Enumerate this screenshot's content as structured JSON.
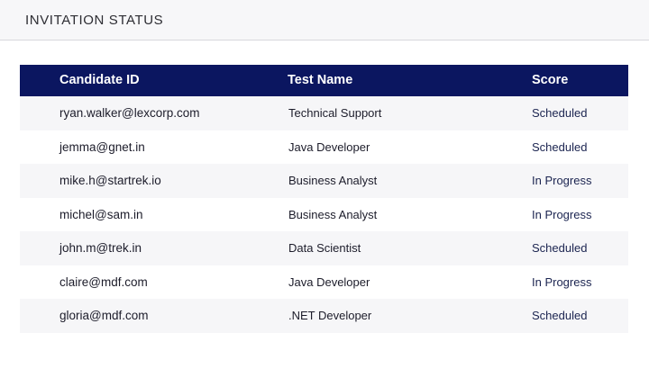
{
  "header": {
    "title": "INVITATION STATUS"
  },
  "table": {
    "columns": [
      "Candidate ID",
      "Test Name",
      "Score"
    ],
    "rows": [
      {
        "candidate_id": "ryan.walker@lexcorp.com",
        "test_name": "Technical Support",
        "score": "Scheduled"
      },
      {
        "candidate_id": "jemma@gnet.in",
        "test_name": "Java Developer",
        "score": "Scheduled"
      },
      {
        "candidate_id": "mike.h@startrek.io",
        "test_name": "Business Analyst",
        "score": "In Progress"
      },
      {
        "candidate_id": "michel@sam.in",
        "test_name": "Business Analyst",
        "score": "In Progress"
      },
      {
        "candidate_id": "john.m@trek.in",
        "test_name": "Data Scientist",
        "score": "Scheduled"
      },
      {
        "candidate_id": "claire@mdf.com",
        "test_name": "Java Developer",
        "score": "In Progress"
      },
      {
        "candidate_id": "gloria@mdf.com",
        "test_name": ".NET Developer",
        "score": "Scheduled"
      }
    ]
  },
  "colors": {
    "header_bg": "#0b1660",
    "stripe_bg": "#f6f6f8",
    "topbar_bg": "#f7f7f9"
  }
}
